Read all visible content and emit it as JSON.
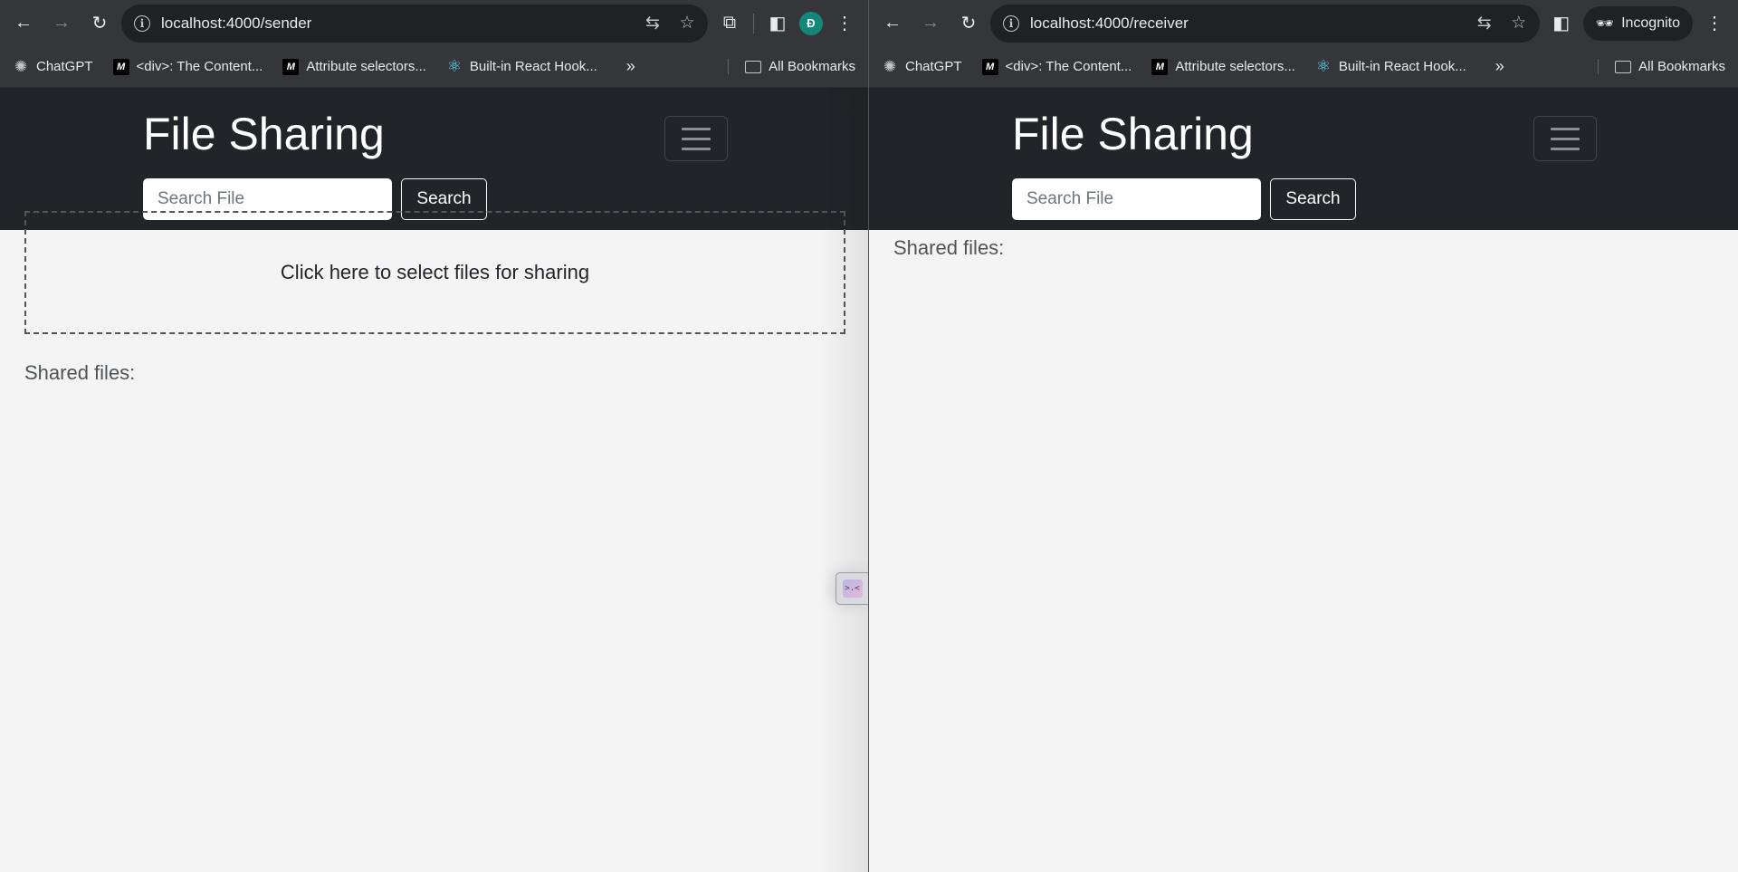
{
  "windows": {
    "sender": {
      "url": "localhost:4000/sender",
      "avatar_letter": "Đ",
      "bookmarks": [
        {
          "label": "ChatGPT",
          "icon": "chatgpt-icon"
        },
        {
          "label": "<div>: The Content...",
          "icon": "mdn-icon"
        },
        {
          "label": "Attribute selectors...",
          "icon": "mdn-icon"
        },
        {
          "label": "Built-in React Hook...",
          "icon": "react-icon"
        }
      ],
      "all_bookmarks": "All Bookmarks",
      "brand": "File Sharing",
      "search_placeholder": "Search File",
      "search_button": "Search",
      "dropzone_text": "Click here to select files for sharing",
      "shared_files_label": "Shared files:"
    },
    "receiver": {
      "url": "localhost:4000/receiver",
      "incognito_label": "Incognito",
      "bookmarks": [
        {
          "label": "ChatGPT",
          "icon": "chatgpt-icon"
        },
        {
          "label": "<div>: The Content...",
          "icon": "mdn-icon"
        },
        {
          "label": "Attribute selectors...",
          "icon": "mdn-icon"
        },
        {
          "label": "Built-in React Hook...",
          "icon": "react-icon"
        }
      ],
      "all_bookmarks": "All Bookmarks",
      "brand": "File Sharing",
      "search_placeholder": "Search File",
      "search_button": "Search",
      "shared_files_label": "Shared files:"
    }
  },
  "colors": {
    "navbar_bg": "#212529",
    "page_bg": "#f4f4f4",
    "chrome_toolbar": "#35363a",
    "avatar_bg": "#12877a"
  }
}
